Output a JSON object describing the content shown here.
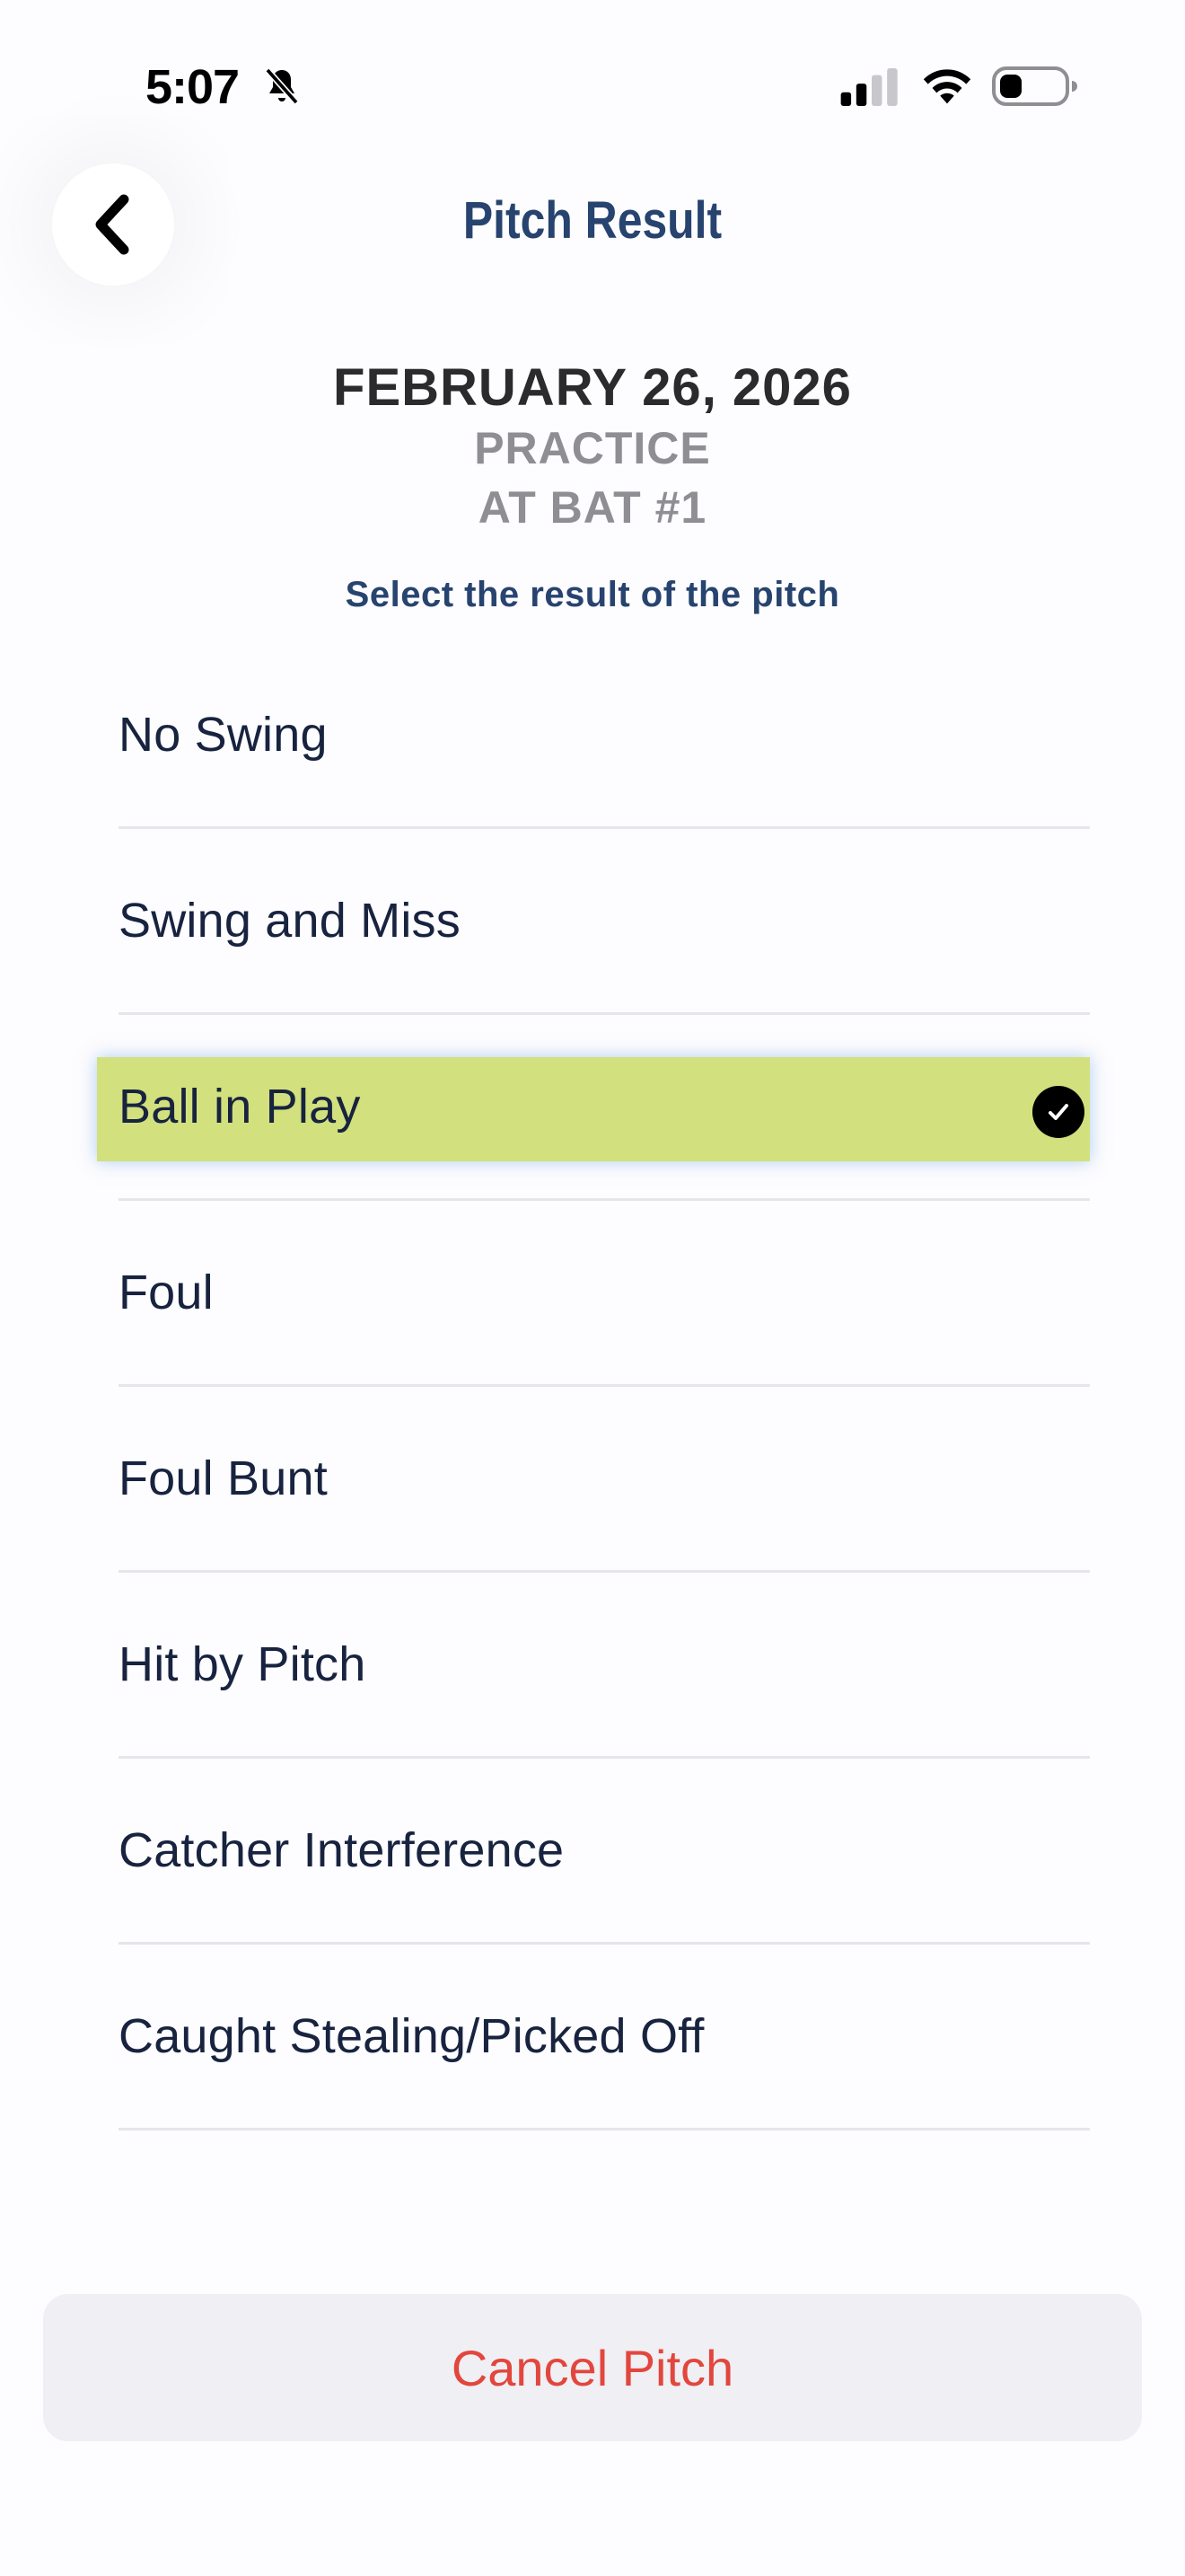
{
  "status_bar": {
    "time": "5:07",
    "icons": [
      "bell-slash-icon",
      "cellular-signal-icon",
      "wifi-icon",
      "battery-icon"
    ]
  },
  "header": {
    "back_icon": "chevron-left-icon",
    "title": "Pitch Result"
  },
  "game": {
    "date": "FEBRUARY 26, 2026",
    "type": "PRACTICE",
    "at_bat": "AT BAT #1"
  },
  "instruction": "Select the result of the pitch",
  "options": [
    {
      "label": "No Swing",
      "selected": false
    },
    {
      "label": "Swing and Miss",
      "selected": false
    },
    {
      "label": "Ball in Play",
      "selected": true
    },
    {
      "label": "Foul",
      "selected": false
    },
    {
      "label": "Foul Bunt",
      "selected": false
    },
    {
      "label": "Hit by Pitch",
      "selected": false
    },
    {
      "label": "Catcher Interference",
      "selected": false
    },
    {
      "label": "Caught Stealing/Picked Off",
      "selected": false
    }
  ],
  "cancel_label": "Cancel Pitch",
  "colors": {
    "title": "#27436f",
    "selected_highlight": "#d2e07d",
    "cancel_text": "#e2463d",
    "cancel_bg": "#efeff4"
  }
}
